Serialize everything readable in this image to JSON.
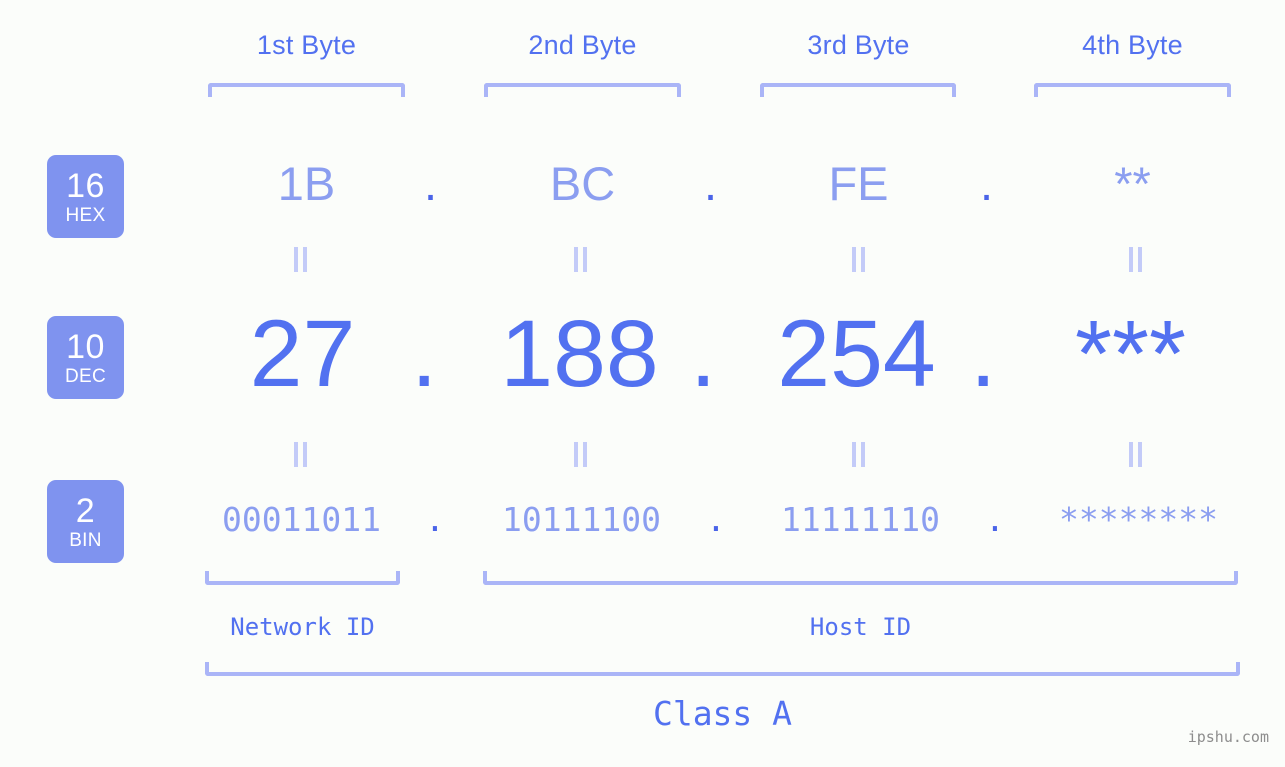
{
  "meta": {
    "watermark": "ipshu.com",
    "accent_dark": "#4a64e8",
    "accent": "#5271f0",
    "accent_light": "#8b9ef0",
    "bracket_color": "#aab5f7",
    "badge_bg": "#7f93ef",
    "background": "#fbfdfa"
  },
  "byte_headers": [
    {
      "label": "1st Byte"
    },
    {
      "label": "2nd Byte"
    },
    {
      "label": "3rd Byte"
    },
    {
      "label": "4th Byte"
    }
  ],
  "rows": {
    "hex": {
      "badge_number": "16",
      "badge_name": "HEX",
      "values": [
        "1B",
        "BC",
        "FE",
        "**"
      ],
      "separator": "."
    },
    "dec": {
      "badge_number": "10",
      "badge_name": "DEC",
      "values": [
        "27",
        "188",
        "254",
        "***"
      ],
      "separator": "."
    },
    "bin": {
      "badge_number": "2",
      "badge_name": "BIN",
      "values": [
        "00011011",
        "10111100",
        "11111110",
        "********"
      ],
      "separator": "."
    }
  },
  "sections": {
    "network_id": "Network ID",
    "host_id": "Host ID",
    "class": "Class A"
  }
}
